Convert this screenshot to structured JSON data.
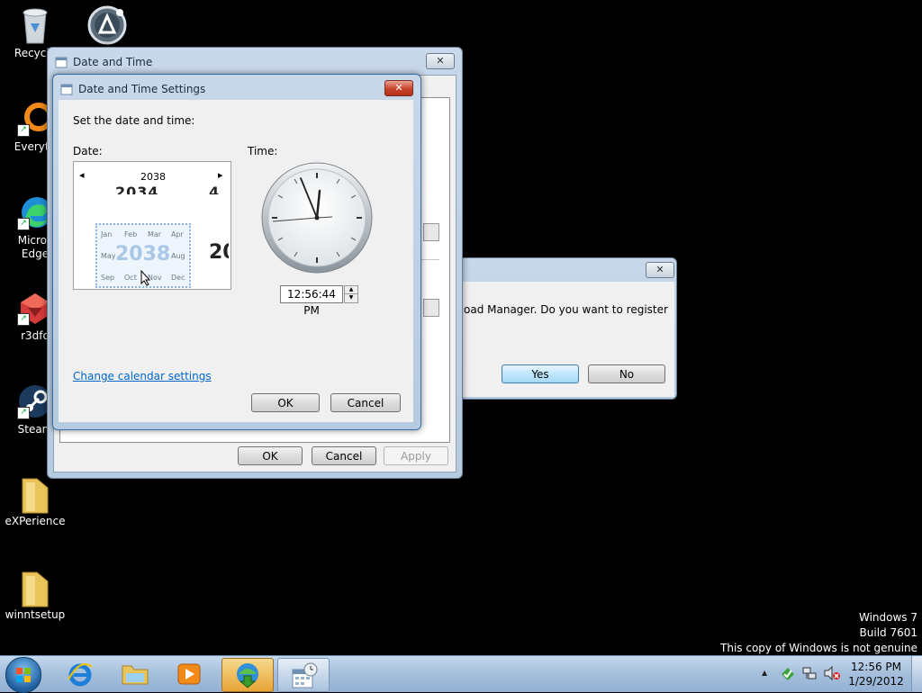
{
  "desktop": {
    "icons": [
      {
        "label": "Recycle",
        "icon": "recycle-bin-icon"
      },
      {
        "label": "",
        "icon": "app-logo-icon"
      },
      {
        "label": "Everyth",
        "icon": "everything-icon"
      },
      {
        "label": "Micros\nEdge",
        "icon": "edge-icon"
      },
      {
        "label": "r3dfo",
        "icon": "r3dfox-icon"
      },
      {
        "label": "Steam",
        "icon": "steam-icon"
      },
      {
        "label": "eXPerience",
        "icon": "folder-icon"
      },
      {
        "label": "winntsetup",
        "icon": "folder-icon"
      }
    ],
    "watermark": {
      "line1": "Windows 7",
      "line2": "Build 7601",
      "line3": "This copy of Windows is not genuine"
    }
  },
  "back_window": {
    "title": "Date and Time",
    "close_label": "✕",
    "ok_label": "OK",
    "cancel_label": "Cancel",
    "apply_label": "Apply"
  },
  "dialog": {
    "title": "Date and Time Settings",
    "close_label": "✕",
    "instruction": "Set the date and time:",
    "date_label": "Date:",
    "time_label": "Time:",
    "calendar": {
      "year": "2038",
      "prev_icon": "◂",
      "next_icon": "▸",
      "ghost_year_left": "2034",
      "ghost_year_right": "20",
      "months": [
        "Jan",
        "Feb",
        "Mar",
        "Apr",
        "May",
        "Jun",
        "Jul",
        "Aug",
        "Sep",
        "Oct",
        "Nov",
        "Dec"
      ],
      "zoom_year": "2038"
    },
    "time_value": "12:56:44 PM",
    "change_calendar_link": "Change calendar settings",
    "ok_label": "OK",
    "cancel_label": "Cancel"
  },
  "popup": {
    "close_label": "✕",
    "message": "oad Manager. Do you want to register",
    "yes_label": "Yes",
    "no_label": "No"
  },
  "taskbar": {
    "clock_time": "12:56 PM",
    "clock_date": "1/29/2012",
    "tray_arrow": "▲"
  },
  "colors": {
    "accent": "#3c7fb1",
    "link": "#0066cc",
    "close_red": "#c7432a"
  }
}
